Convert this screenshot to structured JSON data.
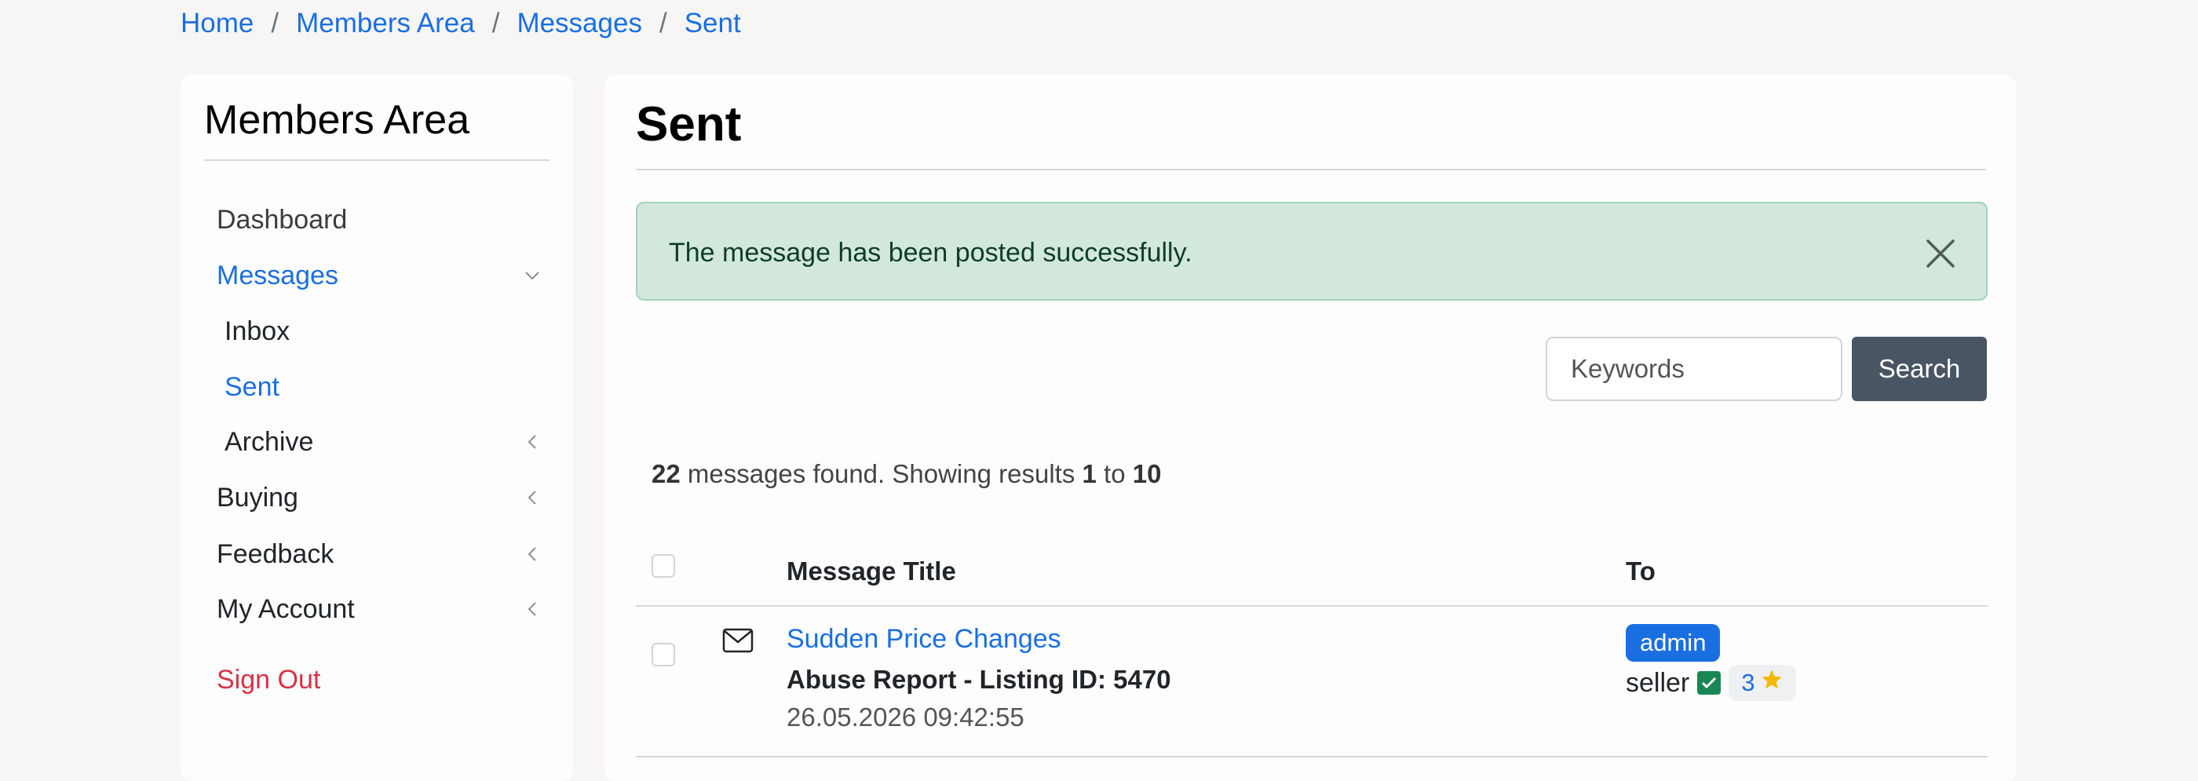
{
  "breadcrumb": [
    {
      "label": "Home"
    },
    {
      "label": "Members Area"
    },
    {
      "label": "Messages"
    },
    {
      "label": "Sent"
    }
  ],
  "breadcrumb_separator": "/",
  "sidebar": {
    "title": "Members Area",
    "items": [
      {
        "label": "Dashboard"
      },
      {
        "label": "Messages",
        "active": true,
        "icon": "chevron-down-icon"
      },
      {
        "label": "Inbox"
      },
      {
        "label": "Sent",
        "active": true
      },
      {
        "label": "Archive",
        "icon": "chevron-left-icon"
      },
      {
        "label": "Buying",
        "icon": "chevron-left-icon"
      },
      {
        "label": "Feedback",
        "icon": "chevron-left-icon"
      },
      {
        "label": "My Account",
        "icon": "chevron-left-icon"
      }
    ],
    "signout": "Sign Out"
  },
  "main": {
    "title": "Sent",
    "alert": "The message has been posted successfully.",
    "search": {
      "placeholder": "Keywords",
      "button": "Search"
    },
    "results": {
      "total": "22",
      "text1": " messages found. Showing results ",
      "from": "1",
      "text2": " to ",
      "to": "10"
    },
    "table": {
      "headers": {
        "title": "Message Title",
        "to": "To"
      },
      "rows": [
        {
          "icon": "envelope-icon",
          "title": "Sudden Price Changes",
          "subtitle": "Abuse Report - Listing ID: 5470",
          "date": "26.05.2026 09:42:55",
          "badge": "admin",
          "recipient": "seller",
          "rating": "3"
        }
      ]
    }
  },
  "colors": {
    "link": "#1a6fe0",
    "danger": "#d63344",
    "alert_bg": "#d2e8dc",
    "button_bg": "#4a5564",
    "verified": "#198754",
    "star": "#f5b800"
  }
}
